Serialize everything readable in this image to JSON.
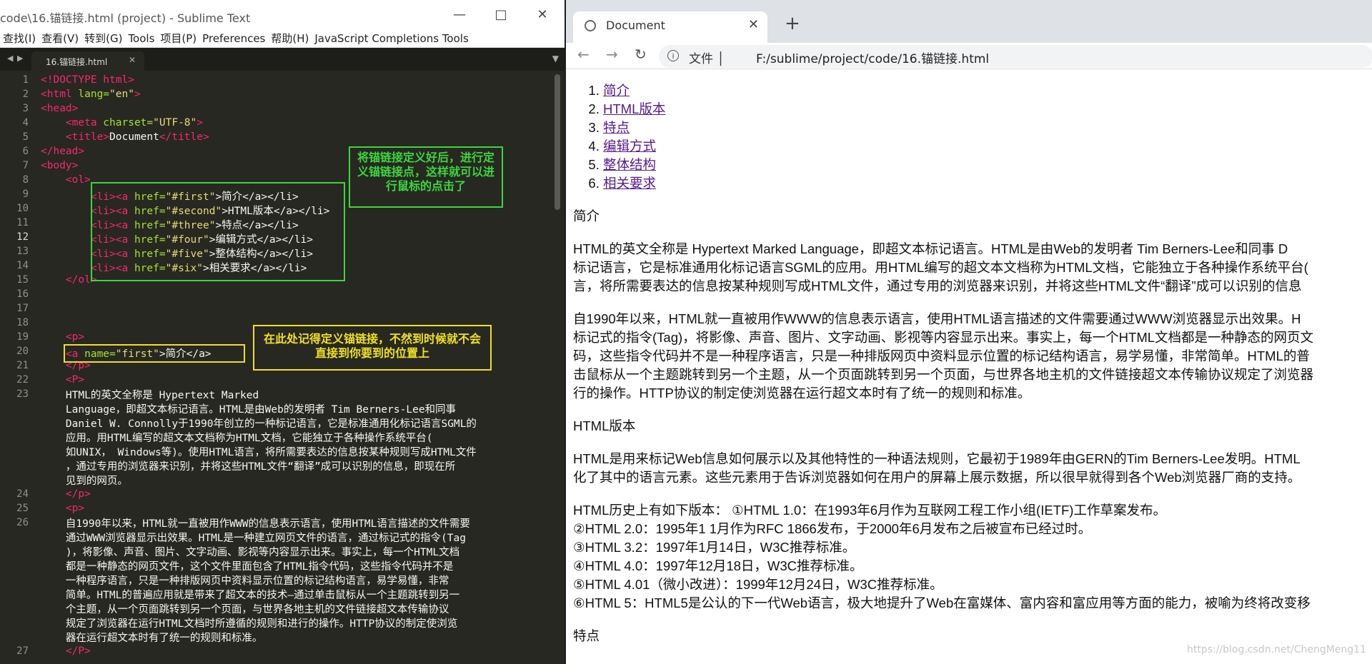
{
  "sublime": {
    "title": "code\\16.锚链接.html (project) - Sublime Text",
    "menu": [
      "查找(I)",
      "查看(V)",
      "转到(G)",
      "Tools",
      "项目(P)",
      "Preferences",
      "帮助(H)",
      "JavaScript Completions Tools"
    ],
    "tab": "16.锚链接.html",
    "line_numbers": [
      "1",
      "2",
      "3",
      "4",
      "5",
      "6",
      "7",
      "8",
      "9",
      "10",
      "11",
      "12",
      "13",
      "14",
      "15",
      "16",
      "17",
      "18",
      "19",
      "20",
      "21",
      "22",
      "23",
      "24",
      "25",
      "26",
      "27"
    ],
    "code": {
      "l1": "<!DOCTYPE html>",
      "l2a": "<html",
      "l2b": " lang=",
      "l2c": "\"en\"",
      "l2d": ">",
      "l3": "<head>",
      "l4a": "    <meta",
      "l4b": " charset=",
      "l4c": "\"UTF-8\"",
      "l4d": ">",
      "l5a": "    <title>",
      "l5b": "Document",
      "l5c": "</title>",
      "l6": "</head>",
      "l7": "<body>",
      "l8": "    <ol>",
      "l9": [
        "        <li><a",
        " href=",
        "\"#first\"",
        ">简介</a></li>"
      ],
      "l10": [
        "        <li><a",
        " href=",
        "\"#second\"",
        ">HTML版本</a></li>"
      ],
      "l11": [
        "        <li><a",
        " href=",
        "\"#three\"",
        ">特点</a></li>"
      ],
      "l12": [
        "        <li><a",
        " href=",
        "\"#four\"",
        ">编辑方式</a></li>"
      ],
      "l13": [
        "        <li><a",
        " href=",
        "\"#five\"",
        ">整体结构</a></li>"
      ],
      "l14": [
        "        <li><a",
        " href=",
        "\"#six\"",
        ">相关要求</a></li>"
      ],
      "l15": "    </ol>",
      "l19": "    <p>",
      "l20": [
        "    <a",
        " name=",
        "\"first\"",
        ">简介</a>"
      ],
      "l21": "    </p>",
      "l22": "    <P>",
      "l23": "    HTML的英文全称是 Hypertext Marked\n    Language，即超文本标记语言。HTML是由Web的发明者 Tim Berners-Lee和同事\n    Daniel W. Connolly于1990年创立的一种标记语言，它是标准通用化标记语言SGML的\n    应用。用HTML编写的超文本文档称为HTML文档，它能独立于各种操作系统平台(\n    如UNIX， Windows等)。使用HTML语言，将所需要表达的信息按某种规则写成HTML文件\n    ，通过专用的浏览器来识别，并将这些HTML文件“翻译”成可以识别的信息，即现在所\n    见到的网页。",
      "l24": "    </p>",
      "l25": "    <p>",
      "l26": "    自1990年以来，HTML就一直被用作WWW的信息表示语言，使用HTML语言描述的文件需要\n    通过WWW浏览器显示出效果。HTML是一种建立网页文件的语言，通过标记式的指令(Tag\n    )，将影像、声音、图片、文字动画、影视等内容显示出来。事实上，每一个HTML文档\n    都是一种静态的网页文件，这个文件里面包含了HTML指令代码，这些指令代码并不是\n    一种程序语言，只是一种排版网页中资料显示位置的标记结构语言，易学易懂，非常\n    简单。HTML的普遍应用就是带来了超文本的技术—通过单击鼠标从一个主题跳转到另一\n    个主题，从一个页面跳转到另一个页面，与世界各地主机的文件链接超文本传输协议\n    规定了浏览器在运行HTML文档时所遵循的规则和进行的操作。HTTP协议的制定使浏览\n    器在运行超文本时有了统一的规则和标准。",
      "l27": "    </P>"
    },
    "note1": "将锚链接定义好后，进行定义锚链接点，这样就可以进行鼠标的点击了",
    "note2": "在此处记得定义锚链接，不然到时候就不会直接到你要到的位置上",
    "colors": {
      "green_note": "#3cd63c",
      "yellow_note": "#f0e020"
    }
  },
  "browser": {
    "tab_title": "Document",
    "address_label": "文件",
    "url": "F:/sublime/project/code/16.锚链接.html",
    "links": [
      "简介",
      "HTML版本",
      "特点",
      "编辑方式",
      "整体结构",
      "相关要求"
    ],
    "h_intro": "简介",
    "p1_1": "HTML的英文全称是 Hypertext Marked Language，即超文本标记语言。HTML是由Web的发明者 Tim Berners-Lee和同事 D",
    "p1_2": "标记语言，它是标准通用化标记语言SGML的应用。用HTML编写的超文本文档称为HTML文档，它能独立于各种操作系统平台(",
    "p1_3": "言，将所需要表达的信息按某种规则写成HTML文件，通过专用的浏览器来识别，并将这些HTML文件“翻译”成可以识别的信息",
    "p2_1": "自1990年以来，HTML就一直被用作WWW的信息表示语言，使用HTML语言描述的文件需要通过WWW浏览器显示出效果。H",
    "p2_2": "标记式的指令(Tag)，将影像、声音、图片、文字动画、影视等内容显示出来。事实上，每一个HTML文档都是一种静态的网页文",
    "p2_3": "码，这些指令代码并不是一种程序语言，只是一种排版网页中资料显示位置的标记结构语言，易学易懂，非常简单。HTML的普",
    "p2_4": "击鼠标从一个主题跳转到另一个主题，从一个页面跳转到另一个页面，与世界各地主机的文件链接超文本传输协议规定了浏览器",
    "p2_5": "行的操作。HTTP协议的制定使浏览器在运行超文本时有了统一的规则和标准。",
    "h_version": "HTML版本",
    "p3_1": "HTML是用来标记Web信息如何展示以及其他特性的一种语法规则，它最初于1989年由GERN的Tim Berners-Lee发明。HTML",
    "p3_2": "化了其中的语言元素。这些元素用于告诉浏览器如何在用户的屏幕上展示数据，所以很早就得到各个Web浏览器厂商的支持。",
    "v1": "HTML历史上有如下版本： ①HTML 1.0：在1993年6月作为互联网工程工作小组(IETF)工作草案发布。",
    "v2": "②HTML 2.0：1995年1 1月作为RFC 1866发布，于2000年6月发布之后被宣布已经过时。",
    "v3": "③HTML 3.2：1997年1月14日，W3C推荐标准。",
    "v4": "④HTML 4.0：1997年12月18日，W3C推荐标准。",
    "v5": "⑤HTML 4.01（微小改进）：1999年12月24日，W3C推荐标准。",
    "v6": "⑥HTML 5：HTML5是公认的下一代Web语言，极大地提升了Web在富媒体、富内容和富应用等方面的能力，被喻为终将改变移",
    "h_features": "特点",
    "watermark": "https://blog.csdn.net/ChengMeng11"
  }
}
